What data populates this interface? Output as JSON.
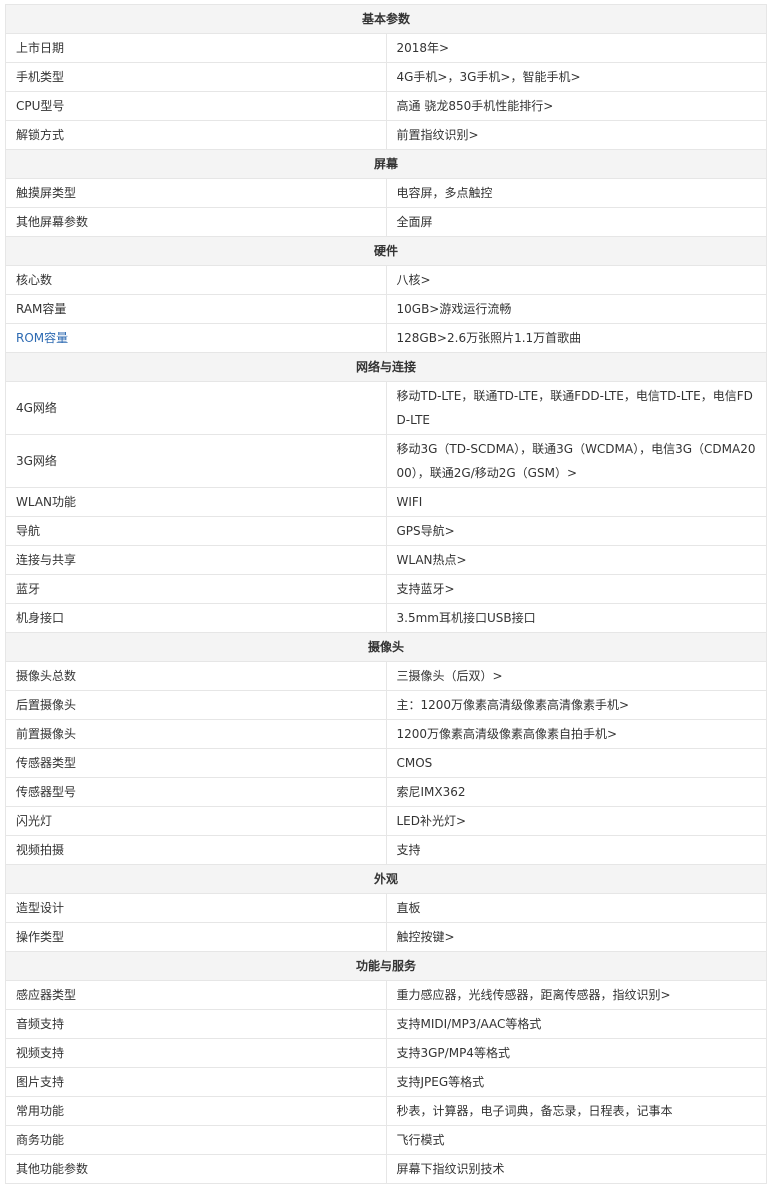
{
  "sections": [
    {
      "title": "基本参数",
      "rows": [
        {
          "label": "上市日期",
          "value": "2018年>"
        },
        {
          "label": "手机类型",
          "value": "4G手机>，3G手机>，智能手机>"
        },
        {
          "label": "CPU型号",
          "value": "高通 骁龙850手机性能排行>"
        },
        {
          "label": "解锁方式",
          "value": "前置指纹识别>"
        }
      ]
    },
    {
      "title": "屏幕",
      "rows": [
        {
          "label": "触摸屏类型",
          "value": "电容屏，多点触控"
        },
        {
          "label": "其他屏幕参数",
          "value": "全面屏"
        }
      ]
    },
    {
      "title": "硬件",
      "rows": [
        {
          "label": "核心数",
          "value": "八核>"
        },
        {
          "label": "RAM容量",
          "value": "10GB>游戏运行流畅"
        },
        {
          "label": "ROM容量",
          "value": "128GB>2.6万张照片1.1万首歌曲",
          "label_link": true
        }
      ]
    },
    {
      "title": "网络与连接",
      "rows": [
        {
          "label": "4G网络",
          "value": "移动TD-LTE，联通TD-LTE，联通FDD-LTE，电信TD-LTE，电信FDD-LTE"
        },
        {
          "label": "3G网络",
          "value": "移动3G（TD-SCDMA），联通3G（WCDMA），电信3G（CDMA2000），联通2G/移动2G（GSM）>"
        },
        {
          "label": "WLAN功能",
          "value": "WIFI"
        },
        {
          "label": "导航",
          "value": "GPS导航>"
        },
        {
          "label": "连接与共享",
          "value": "WLAN热点>"
        },
        {
          "label": "蓝牙",
          "value": "支持蓝牙>"
        },
        {
          "label": "机身接口",
          "value": "3.5mm耳机接口USB接口"
        }
      ]
    },
    {
      "title": "摄像头",
      "rows": [
        {
          "label": "摄像头总数",
          "value": "三摄像头（后双）>"
        },
        {
          "label": "后置摄像头",
          "value": "主：1200万像素高清级像素高清像素手机>"
        },
        {
          "label": "前置摄像头",
          "value": "1200万像素高清级像素高像素自拍手机>"
        },
        {
          "label": "传感器类型",
          "value": "CMOS"
        },
        {
          "label": "传感器型号",
          "value": "索尼IMX362"
        },
        {
          "label": "闪光灯",
          "value": "LED补光灯>"
        },
        {
          "label": "视频拍摄",
          "value": "支持"
        }
      ]
    },
    {
      "title": "外观",
      "rows": [
        {
          "label": "造型设计",
          "value": "直板"
        },
        {
          "label": "操作类型",
          "value": "触控按键>"
        }
      ]
    },
    {
      "title": "功能与服务",
      "rows": [
        {
          "label": "感应器类型",
          "value": "重力感应器，光线传感器，距离传感器，指纹识别>"
        },
        {
          "label": "音频支持",
          "value": "支持MIDI/MP3/AAC等格式"
        },
        {
          "label": "视频支持",
          "value": "支持3GP/MP4等格式"
        },
        {
          "label": "图片支持",
          "value": "支持JPEG等格式"
        },
        {
          "label": "常用功能",
          "value": "秒表，计算器，电子词典，备忘录，日程表，记事本"
        },
        {
          "label": "商务功能",
          "value": "飞行模式"
        },
        {
          "label": "其他功能参数",
          "value": "屏幕下指纹识别技术"
        }
      ]
    }
  ]
}
